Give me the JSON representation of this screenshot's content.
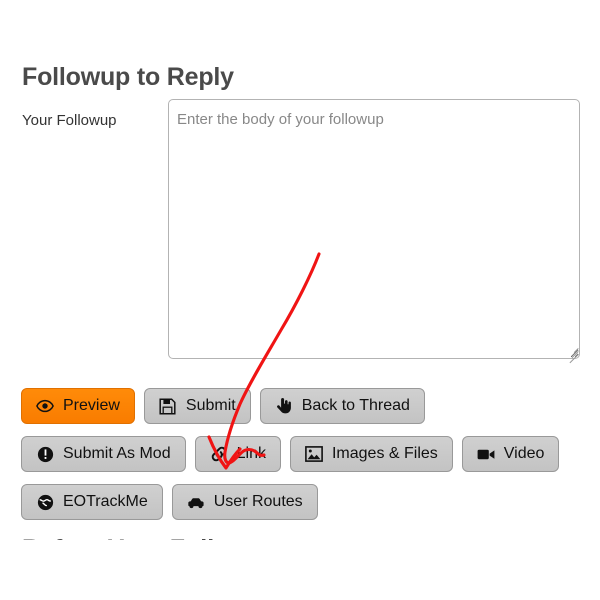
{
  "page": {
    "title": "Followup to Reply",
    "next_section_title": "Before Your Followup"
  },
  "form": {
    "label": "Your Followup",
    "textarea": {
      "value": "",
      "placeholder": "Enter the body of your followup"
    }
  },
  "buttons": {
    "row1": [
      {
        "label": "Preview",
        "icon": "eye-icon",
        "style": "primary"
      },
      {
        "label": "Submit",
        "icon": "floppy-disk-icon",
        "style": "default"
      },
      {
        "label": "Back to Thread",
        "icon": "hand-pointer-icon",
        "style": "default"
      }
    ],
    "row2": [
      {
        "label": "Submit As Mod",
        "icon": "exclamation-circle-icon",
        "style": "default"
      },
      {
        "label": "Link",
        "icon": "chain-link-icon",
        "style": "default"
      },
      {
        "label": "Images & Files",
        "icon": "image-icon",
        "style": "default"
      },
      {
        "label": "Video",
        "icon": "video-camera-icon",
        "style": "default"
      }
    ],
    "row3": [
      {
        "label": "EOTrackMe",
        "icon": "globe-icon",
        "style": "default"
      },
      {
        "label": "User Routes",
        "icon": "car-icon",
        "style": "default"
      }
    ]
  },
  "annotation": {
    "type": "hand-drawn-arrow",
    "color": "#f01414",
    "points_at": "Link"
  },
  "colors": {
    "primary_button": "#ff8000",
    "default_button": "#c9c9c9",
    "button_border": "#999999",
    "heading_text": "#4a4a4a",
    "body_text": "#333333",
    "placeholder_text": "#888888",
    "input_border": "#b3b3b3",
    "annotation_red": "#f01414",
    "background": "#ffffff"
  }
}
